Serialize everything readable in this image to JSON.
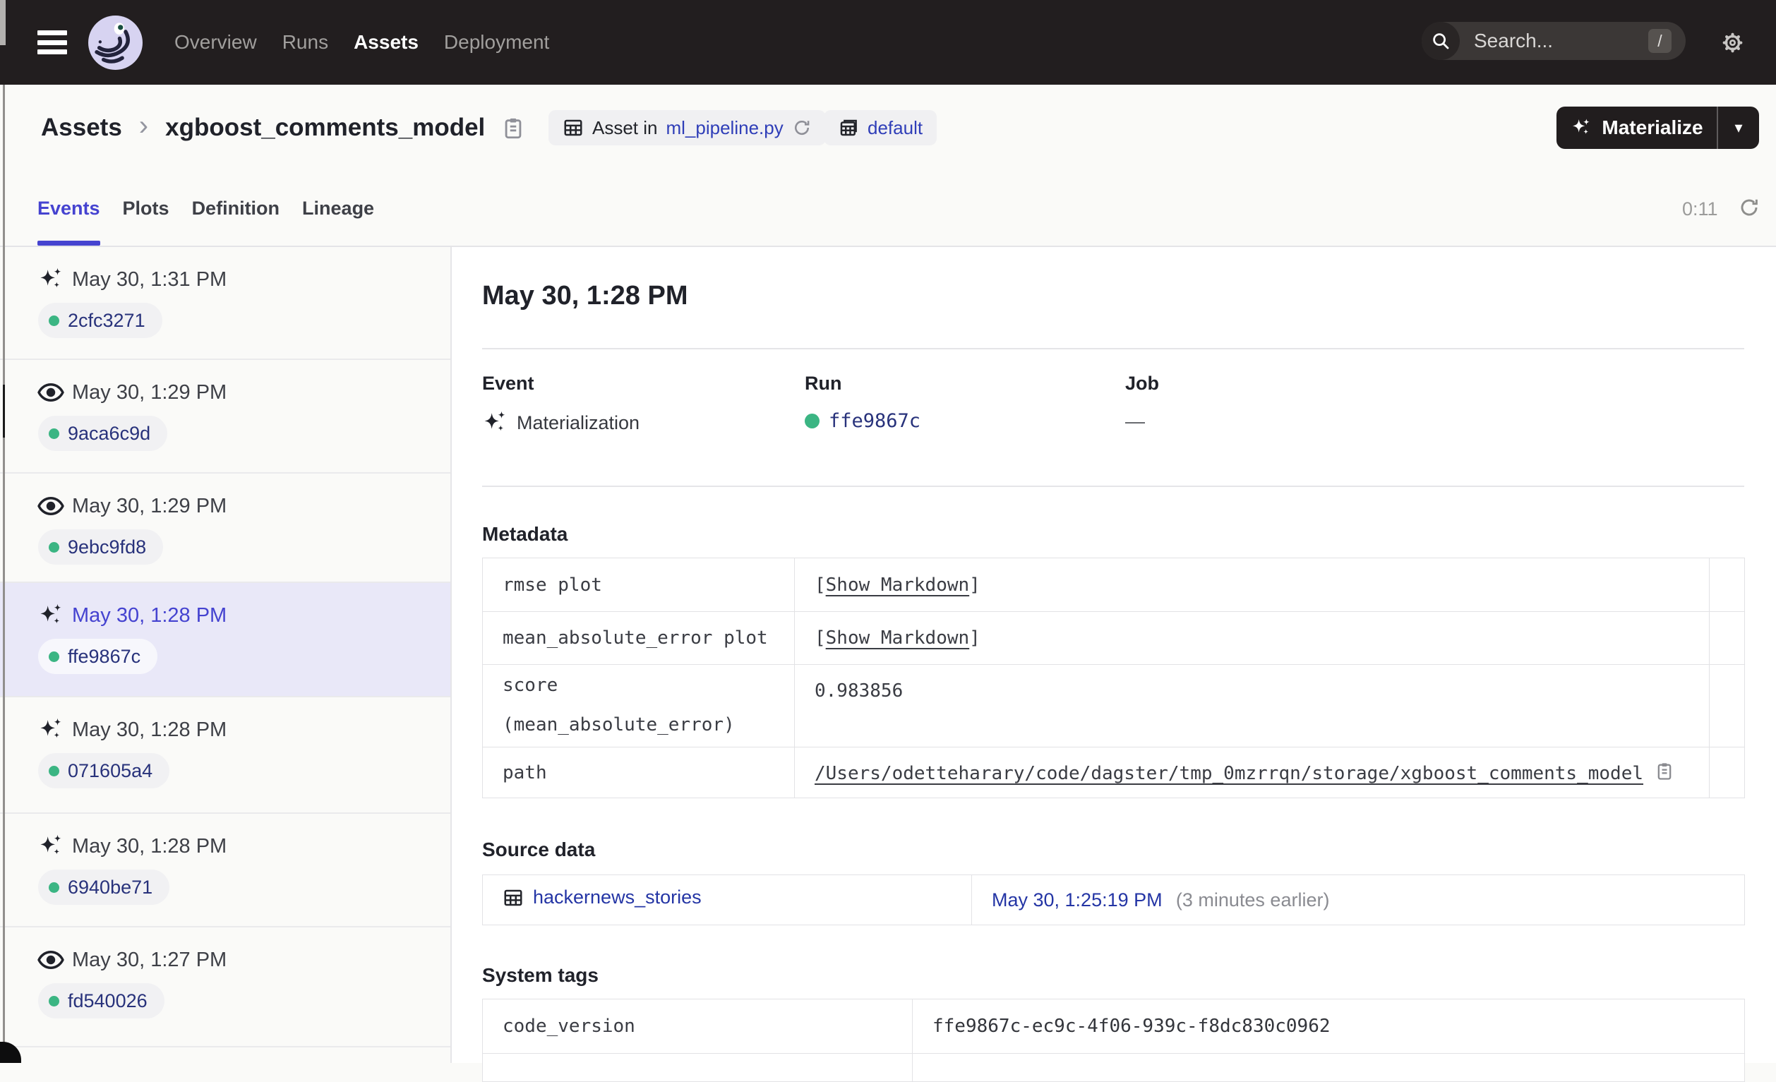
{
  "header": {
    "nav": [
      {
        "label": "Overview",
        "active": false
      },
      {
        "label": "Runs",
        "active": false
      },
      {
        "label": "Assets",
        "active": true
      },
      {
        "label": "Deployment",
        "active": false
      }
    ],
    "search": {
      "placeholder": "Search...",
      "shortcut": "/"
    }
  },
  "breadcrumb": {
    "root": "Assets",
    "separator": "›",
    "asset_name": "xgboost_comments_model"
  },
  "asset_tags": {
    "asset_in_prefix": "Asset in",
    "asset_file": "ml_pipeline.py",
    "repo": "default"
  },
  "materialize": {
    "label": "Materialize",
    "caret": "▾"
  },
  "tabs": {
    "items": [
      "Events",
      "Plots",
      "Definition",
      "Lineage"
    ],
    "active": "Events",
    "timer": "0:11"
  },
  "sidebar": {
    "events": [
      {
        "time": "May 30, 1:31 PM",
        "run_id": "2cfc3271",
        "icon": "materialization-sparkle-icon",
        "selected": false
      },
      {
        "time": "May 30, 1:29 PM",
        "run_id": "9aca6c9d",
        "icon": "observation-eye-icon",
        "selected": false
      },
      {
        "time": "May 30, 1:29 PM",
        "run_id": "9ebc9fd8",
        "icon": "observation-eye-icon",
        "selected": false
      },
      {
        "time": "May 30, 1:28 PM",
        "run_id": "ffe9867c",
        "icon": "materialization-sparkle-icon",
        "selected": true
      },
      {
        "time": "May 30, 1:28 PM",
        "run_id": "071605a4",
        "icon": "materialization-sparkle-icon",
        "selected": false
      },
      {
        "time": "May 30, 1:28 PM",
        "run_id": "6940be71",
        "icon": "materialization-sparkle-icon",
        "selected": false
      },
      {
        "time": "May 30, 1:27 PM",
        "run_id": "fd540026",
        "icon": "observation-eye-icon",
        "selected": false
      }
    ]
  },
  "detail": {
    "title": "May 30, 1:28 PM",
    "event_label": "Event",
    "event_value": "Materialization",
    "run_label": "Run",
    "run_id": "ffe9867c",
    "job_label": "Job",
    "job_value": "—",
    "metadata_title": "Metadata",
    "bracket_open": "[",
    "bracket_close": "]",
    "metadata_rows": [
      {
        "key": "rmse plot",
        "value": "Show Markdown",
        "type": "markdown-link"
      },
      {
        "key": "mean_absolute_error plot",
        "value": "Show Markdown",
        "type": "markdown-link"
      },
      {
        "key": "score (mean_absolute_error)",
        "value": "0.983856",
        "type": "text"
      },
      {
        "key": "path",
        "value": "/Users/odetteharary/code/dagster/tmp_0mzrrqn/storage/xgboost_comments_model",
        "type": "path-link"
      }
    ],
    "source_title": "Source data",
    "source": {
      "asset": "hackernews_stories",
      "timestamp": "May 30, 1:25:19 PM",
      "relative": "(3 minutes earlier)"
    },
    "system_tags_title": "System tags",
    "system_tags": [
      {
        "key": "code_version",
        "value": "ffe9867c-ec9c-4f06-939c-f8dc830c0962"
      }
    ]
  },
  "colors": {
    "accent": "#4543D0",
    "link_blue": "#2F3EB8",
    "run_navy": "#28327B",
    "header_bg": "#221E1F",
    "success_green": "#3BB583",
    "selected_bg": "#E9E8F8"
  }
}
